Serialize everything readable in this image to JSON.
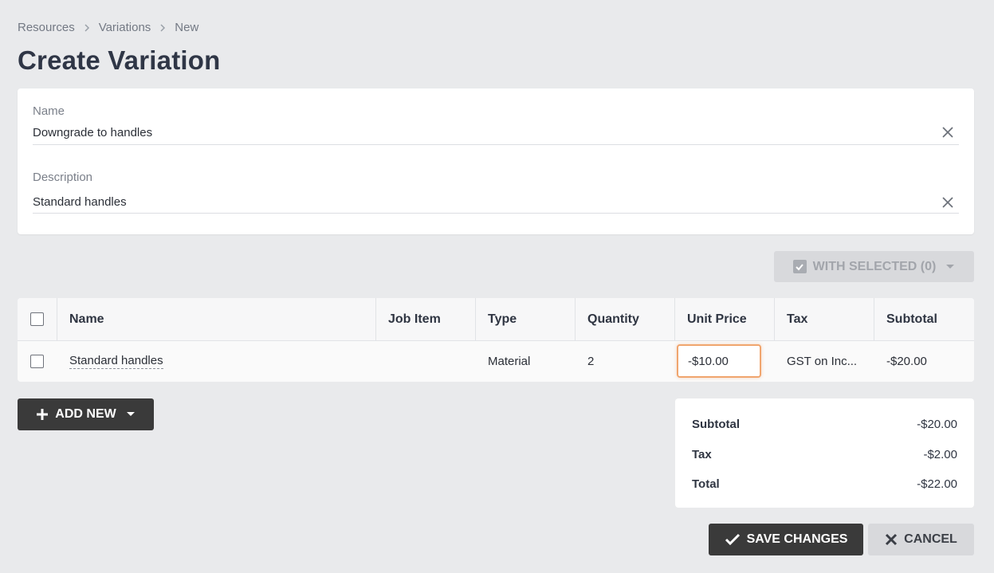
{
  "breadcrumb": [
    "Resources",
    "Variations",
    "New"
  ],
  "page_title": "Create Variation",
  "form": {
    "name_label": "Name",
    "name_value": "Downgrade to handles",
    "description_label": "Description",
    "description_value": "Standard handles"
  },
  "bulk": {
    "with_selected_label": "WITH SELECTED (0)"
  },
  "table": {
    "columns": [
      "Name",
      "Job Item",
      "Type",
      "Quantity",
      "Unit Price",
      "Tax",
      "Subtotal"
    ],
    "rows": [
      {
        "name": "Standard handles",
        "job_item": "",
        "type": "Material",
        "quantity": "2",
        "unit_price": "-$10.00",
        "tax": "GST on Inc...",
        "subtotal": "-$20.00"
      }
    ]
  },
  "add_new_label": "ADD NEW",
  "totals": {
    "subtotal_label": "Subtotal",
    "subtotal_value": "-$20.00",
    "tax_label": "Tax",
    "tax_value": "-$2.00",
    "total_label": "Total",
    "total_value": "-$22.00"
  },
  "actions": {
    "save_label": "SAVE CHANGES",
    "cancel_label": "CANCEL"
  },
  "colors": {
    "accent_focus": "#f0a56e",
    "button_dark": "#3a3a3a",
    "button_light": "#d8d9dc",
    "background": "#e9eaec"
  },
  "icons": {
    "breadcrumb_separator": "chevron-right-icon",
    "clear": "close-icon",
    "with_selected": "checkbox-checked-icon",
    "dropdown": "caret-down-icon",
    "add": "plus-icon",
    "save": "check-icon",
    "cancel": "close-icon"
  }
}
